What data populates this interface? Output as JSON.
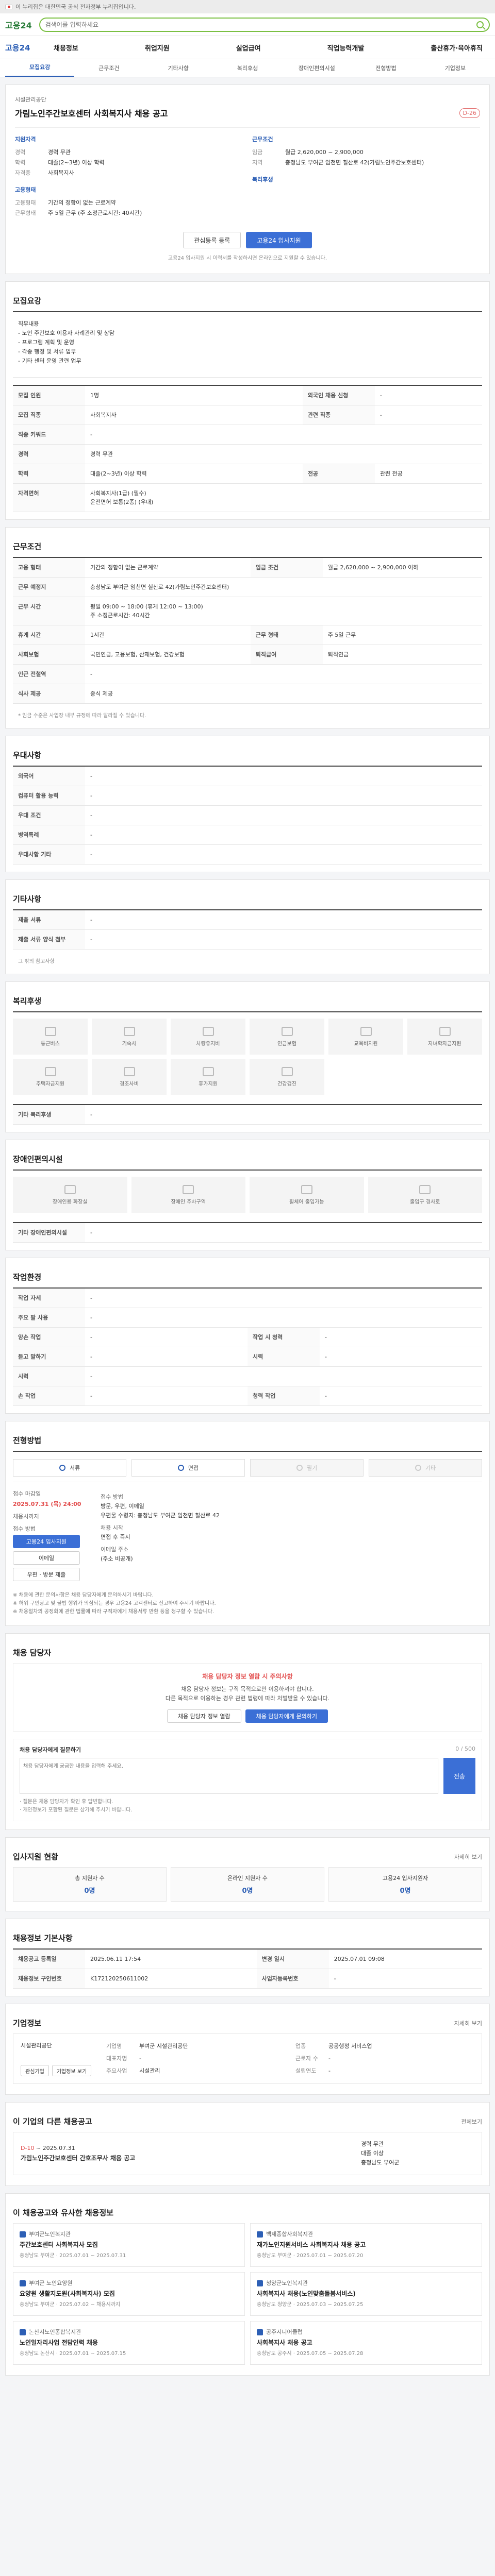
{
  "topbar": {
    "text": "이 누리집은 대한민국 공식 전자정부 누리집입니다."
  },
  "search": {
    "logo": "고용24",
    "placeholder": "검색어를 입력하세요"
  },
  "gnb": {
    "brand": "고용24",
    "items": [
      "채용정보",
      "취업지원",
      "실업급여",
      "직업능력개발",
      "출산휴가·육아휴직"
    ]
  },
  "subtabs": [
    "모집요강",
    "근무조건",
    "기타사항",
    "복리후생",
    "장애인편의시설",
    "전형방법",
    "기업정보"
  ],
  "job": {
    "company": "시설관리공단",
    "title": "가림노인주간보호센터 사회복지사 채용 공고",
    "dday": "D-26",
    "left_title": "지원자격",
    "left": [
      {
        "k": "경력",
        "v": "경력 무관"
      },
      {
        "k": "학력",
        "v": "대졸(2~3년) 이상 학력"
      },
      {
        "k": "자격증",
        "v": "사회복지사"
      }
    ],
    "right_title": "근무조건",
    "right": [
      {
        "k": "임금",
        "v": "월급 2,620,000 ~ 2,900,000"
      },
      {
        "k": "지역",
        "v": "충청남도 부여군 임천면 칠산로 42(가림노인주간보호센터)"
      }
    ],
    "left2_title": "고용형태",
    "left2": [
      {
        "k": "고용형태",
        "v": "기간의 정함이 없는 근로계약"
      },
      {
        "k": "근무형태",
        "v": "주 5일 근무 (주 소정근로시간: 40시간)"
      }
    ],
    "right2_title": "복리후생",
    "btn_scrap": "관심등록 등록",
    "btn_apply": "고용24 입사지원",
    "note": "고용24 입사지원 시 이력서를 작성하시면 온라인으로 지원할 수 있습니다."
  },
  "recruit": {
    "title": "모집요강",
    "duty_label": "직무내용",
    "duty": "직무내용\n- 노인 주간보호 이용자 사례관리 및 상담\n- 프로그램 계획 및 운영\n- 각종 행정 및 서류 업무\n- 기타 센터 운영 관련 업무",
    "rows": [
      {
        "k": "모집 인원",
        "v": "1명",
        "k2": "외국인 채용 신청",
        "v2": "-"
      },
      {
        "k": "모집 직종",
        "v": "사회복지사",
        "k2": "관련 직종",
        "v2": "-"
      },
      {
        "k": "직종 키워드",
        "v": "-",
        "k2": "",
        "v2": ""
      },
      {
        "k": "경력",
        "v": "경력 무관",
        "k2": "",
        "v2": ""
      },
      {
        "k": "학력",
        "v": "대졸(2~3년) 이상 학력",
        "k2": "전공",
        "v2": "관련 전공"
      },
      {
        "k": "자격면허",
        "v": "사회복지사(1급) (필수)\n운전면허 보통(2종) (우대)",
        "k2": "",
        "v2": ""
      }
    ]
  },
  "work": {
    "title": "근무조건",
    "rows": [
      {
        "k": "고용 형태",
        "v": "기간의 정함이 없는 근로계약",
        "k2": "임금 조건",
        "v2": "월급 2,620,000 ~ 2,900,000 이하"
      },
      {
        "k": "근무 예정지",
        "v": "충청남도 부여군 임천면 칠산로 42(가림노인주간보호센터)",
        "k2": "",
        "v2": ""
      },
      {
        "k": "근무 시간",
        "v": "평일 09:00 ~ 18:00 (휴게 12:00 ~ 13:00)\n주 소정근로시간: 40시간",
        "k2": "",
        "v2": ""
      },
      {
        "k": "휴게 시간",
        "v": "1시간",
        "k2": "근무 형태",
        "v2": "주 5일 근무"
      },
      {
        "k": "사회보험",
        "v": "국민연금, 고용보험, 산재보험, 건강보험",
        "k2": "퇴직급여",
        "v2": "퇴직연금"
      },
      {
        "k": "인근 전철역",
        "v": "-",
        "k2": "",
        "v2": ""
      },
      {
        "k": "식사 제공",
        "v": "중식 제공",
        "k2": "",
        "v2": ""
      }
    ],
    "note": "* 임금 수준은 사업장 내부 규정에 따라 달라질 수 있습니다."
  },
  "welfare": {
    "title": "우대사항",
    "rows": [
      {
        "k": "외국어",
        "v": "-"
      },
      {
        "k": "컴퓨터 활용 능력",
        "v": "-"
      },
      {
        "k": "우대 조건",
        "v": "-"
      },
      {
        "k": "병역특례",
        "v": "-"
      },
      {
        "k": "우대사항 기타",
        "v": "-"
      }
    ]
  },
  "etc": {
    "title": "기타사항",
    "rows": [
      {
        "k": "제출 서류",
        "v": "-"
      },
      {
        "k": "제출 서류 양식 첨부",
        "v": "-"
      }
    ],
    "note": "그 밖의 참고사항"
  },
  "benefit": {
    "title": "복리후생",
    "items": [
      "통근버스",
      "기숙사",
      "차량유지비",
      "연금보험",
      "교육비지원",
      "자녀학자금지원",
      "주택자금지원",
      "경조사비",
      "휴가지원",
      "건강검진"
    ],
    "etc_title": "기타 복리후생",
    "etc": "-"
  },
  "facility": {
    "title": "장애인편의시설",
    "items": [
      "장애인용 화장실",
      "장애인 주차구역",
      "휠체어 출입가능",
      "출입구 경사로"
    ],
    "etc_title": "기타 장애인편의시설",
    "etc": "-"
  },
  "place": {
    "title": "작업환경",
    "rows": [
      {
        "k": "작업 자세",
        "v": "-",
        "k2": "",
        "v2": ""
      },
      {
        "k": "주요 팔 사용",
        "v": "-",
        "k2": "",
        "v2": ""
      },
      {
        "k": "양손 작업",
        "v": "-",
        "k2": "작업 시 청력",
        "v2": "-"
      },
      {
        "k": "듣고 말하기",
        "v": "-",
        "k2": "시력",
        "v2": "-"
      },
      {
        "k": "시력",
        "v": "-",
        "k2": "",
        "v2": ""
      },
      {
        "k": "손 작업",
        "v": "-",
        "k2": "청력 작업",
        "v2": "-"
      }
    ]
  },
  "process": {
    "title": "전형방법",
    "steps": [
      "서류",
      "면접",
      "필기",
      "기타"
    ],
    "off": [
      false,
      false,
      true,
      true
    ],
    "deadline_label": "접수 마감일",
    "deadline": "2025.07.31 (목) 24:00",
    "deadline_note": "채용시까지",
    "apply_label": "접수 방법",
    "btn1": "고용24 입사지원",
    "btn2": "이메일",
    "btn3": "우편 · 방문 제출",
    "method_label": "접수 방법",
    "method": "방문, 우편, 이메일",
    "addr": "우편물 수령지: 충청남도 부여군 임천면 칠산로 42",
    "period_label": "채용 시작",
    "period": "면접 후 즉시",
    "email_label": "이메일 주소",
    "email": "(주소 비공개)",
    "notes": [
      "※ 채용에 관한 문의사항은 채용 담당자에게 문의하시기 바랍니다.",
      "※ 허위 구인광고 및 불법 행위가 의심되는 경우 고용24 고객센터로 신고하여 주시기 바랍니다.",
      "※ 채용절차의 공정화에 관한 법률에 따라 구직자에게 채용서류 반환 등을 청구할 수 있습니다."
    ]
  },
  "manager": {
    "title": "채용 담당자",
    "warn": "채용 담당자 정보 열람 시 주의사항",
    "desc": "채용 담당자 정보는 구직 목적으로만 이용하셔야 합니다.\n다른 목적으로 이용하는 경우 관련 법령에 따라 처벌받을 수 있습니다.",
    "btn1": "채용 담당자 정보 열람",
    "btn2": "채용 담당자에게 문의하기",
    "ask_title": "채용 담당자에게 질문하기",
    "ask_count": "0 / 500",
    "ask_placeholder": "채용 담당자에게 궁금한 내용을 입력해 주세요.",
    "ask_send": "전송",
    "ask_notes": [
      "· 질문은 채용 담당자가 확인 후 답변합니다.",
      "· 개인정보가 포함된 질문은 삼가해 주시기 바랍니다."
    ]
  },
  "status": {
    "title": "입사지원 현황",
    "more": "자세히 보기",
    "items": [
      {
        "label": "총 지원자 수",
        "num": "0명"
      },
      {
        "label": "온라인 지원자 수",
        "num": "0명"
      },
      {
        "label": "고용24 입사지원자",
        "num": "0명"
      }
    ]
  },
  "info": {
    "title": "채용정보 기본사항",
    "rows": [
      {
        "k": "채용공고 등록일",
        "v": "2025.06.11 17:54",
        "k2": "변경 일시",
        "v2": "2025.07.01 09:08"
      },
      {
        "k": "채용정보 구인번호",
        "v": "K172120250611002",
        "k2": "사업자등록번호",
        "v2": "-"
      }
    ]
  },
  "company": {
    "title": "기업정보",
    "more": "자세히 보기",
    "name": "시설관리공단",
    "btn1": "관심기업",
    "btn2": "기업정보 보기",
    "rows": [
      {
        "k": "기업명",
        "v": "부여군 시설관리공단"
      },
      {
        "k": "업종",
        "v": "공공행정 서비스업"
      },
      {
        "k": "대표자명",
        "v": "-"
      },
      {
        "k": "근로자 수",
        "v": "-"
      },
      {
        "k": "주요사업",
        "v": "시설관리"
      },
      {
        "k": "설립연도",
        "v": "-"
      }
    ]
  },
  "similar": {
    "title": "이 기업의 다른 채용공고",
    "more": "전체보기",
    "dday": "D-10",
    "date": "~ 2025.07.31",
    "job_title": "가림노인주간보호센터 간호조무사 채용 공고",
    "info1": "경력 무관",
    "info2": "대졸 이상",
    "info3": "충청남도 부여군"
  },
  "recommend": {
    "title": "이 채용공고와 유사한 채용정보",
    "items": [
      {
        "co": "부여군노인복지관",
        "t": "주간보호센터 사회복지사 모집",
        "meta": "충청남도 부여군 · 2025.07.01 ~ 2025.07.31"
      },
      {
        "co": "백제종합사회복지관",
        "t": "재가노인지원서비스 사회복지사 채용 공고",
        "meta": "충청남도 부여군 · 2025.07.01 ~ 2025.07.20"
      },
      {
        "co": "부여군 노인요양원",
        "t": "요양원 생활지도원(사회복지사) 모집",
        "meta": "충청남도 부여군 · 2025.07.02 ~ 채용시까지"
      },
      {
        "co": "청양군노인복지관",
        "t": "사회복지사 채용(노인맞춤돌봄서비스)",
        "meta": "충청남도 청양군 · 2025.07.03 ~ 2025.07.25"
      },
      {
        "co": "논산시노인종합복지관",
        "t": "노인일자리사업 전담인력 채용",
        "meta": "충청남도 논산시 · 2025.07.01 ~ 2025.07.15"
      },
      {
        "co": "공주시니어클럽",
        "t": "사회복지사 채용 공고",
        "meta": "충청남도 공주시 · 2025.07.05 ~ 2025.07.28"
      }
    ]
  }
}
